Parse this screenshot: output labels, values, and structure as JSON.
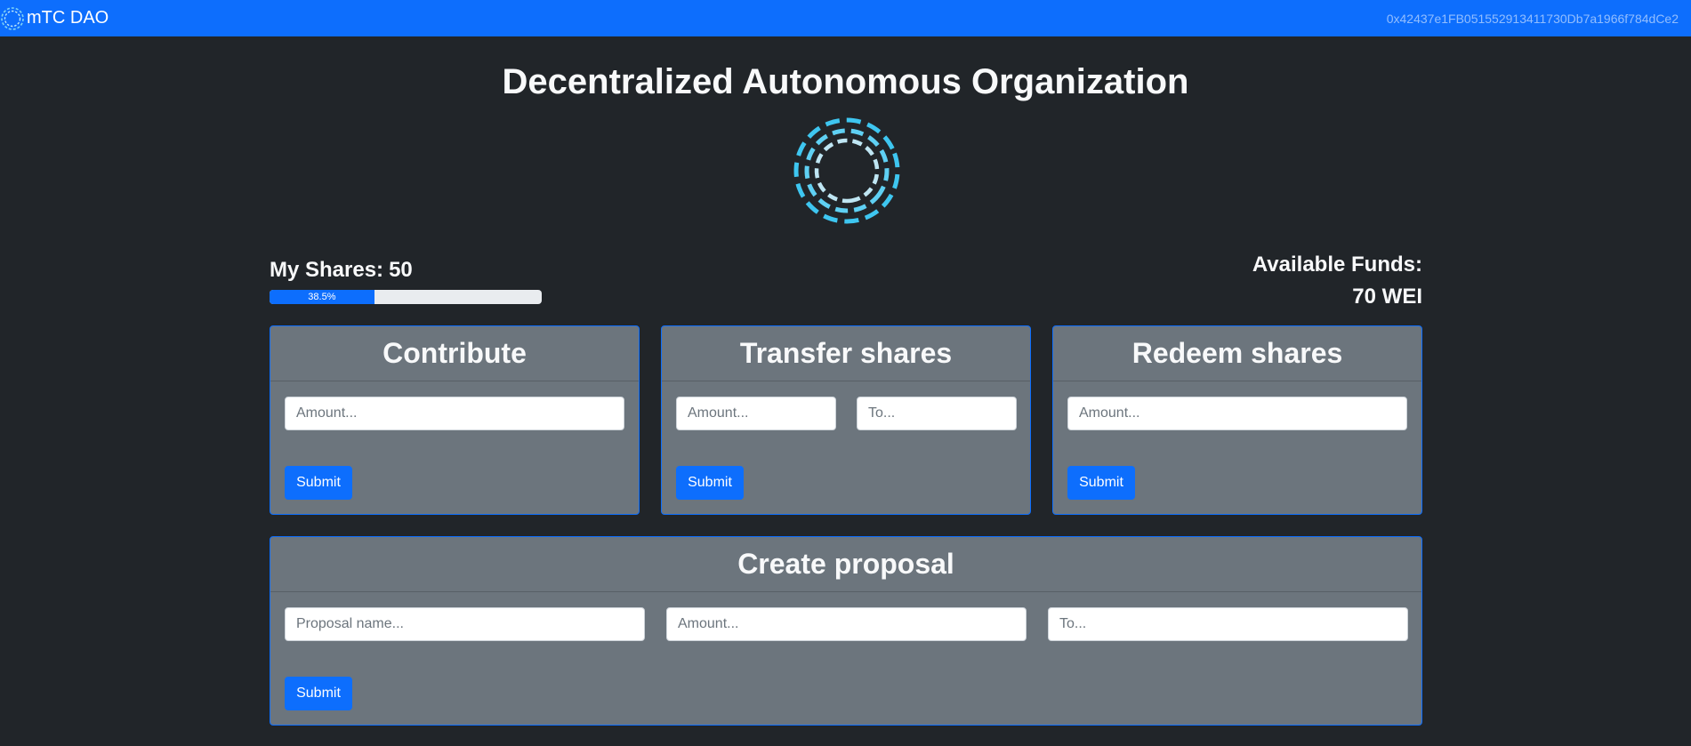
{
  "navbar": {
    "brand": "mTC DAO",
    "account": "0x42437e1FB051552913411730Db7a1966f784dCe2",
    "logo_icon": "dashed-circle-logo-icon"
  },
  "main": {
    "title": "Decentralized Autonomous Organization",
    "loader_icon": "dashed-rings-spinner-icon"
  },
  "shares": {
    "label": "My Shares:",
    "value": "50",
    "progress_text": "38.5%",
    "progress_fraction": 0.385
  },
  "funds": {
    "label": "Available Funds:",
    "value": "70 WEI"
  },
  "contribute": {
    "title": "Contribute",
    "amount_placeholder": "Amount...",
    "submit_label": "Submit"
  },
  "transfer": {
    "title": "Transfer shares",
    "amount_placeholder": "Amount...",
    "to_placeholder": "To...",
    "submit_label": "Submit"
  },
  "redeem": {
    "title": "Redeem shares",
    "amount_placeholder": "Amount...",
    "submit_label": "Submit"
  },
  "proposal": {
    "title": "Create proposal",
    "name_placeholder": "Proposal name...",
    "amount_placeholder": "Amount...",
    "to_placeholder": "To...",
    "submit_label": "Submit"
  },
  "colors": {
    "primary": "#0d6efd",
    "background": "#212529",
    "card": "#6c757d",
    "spinner": "#3ec6f0"
  }
}
